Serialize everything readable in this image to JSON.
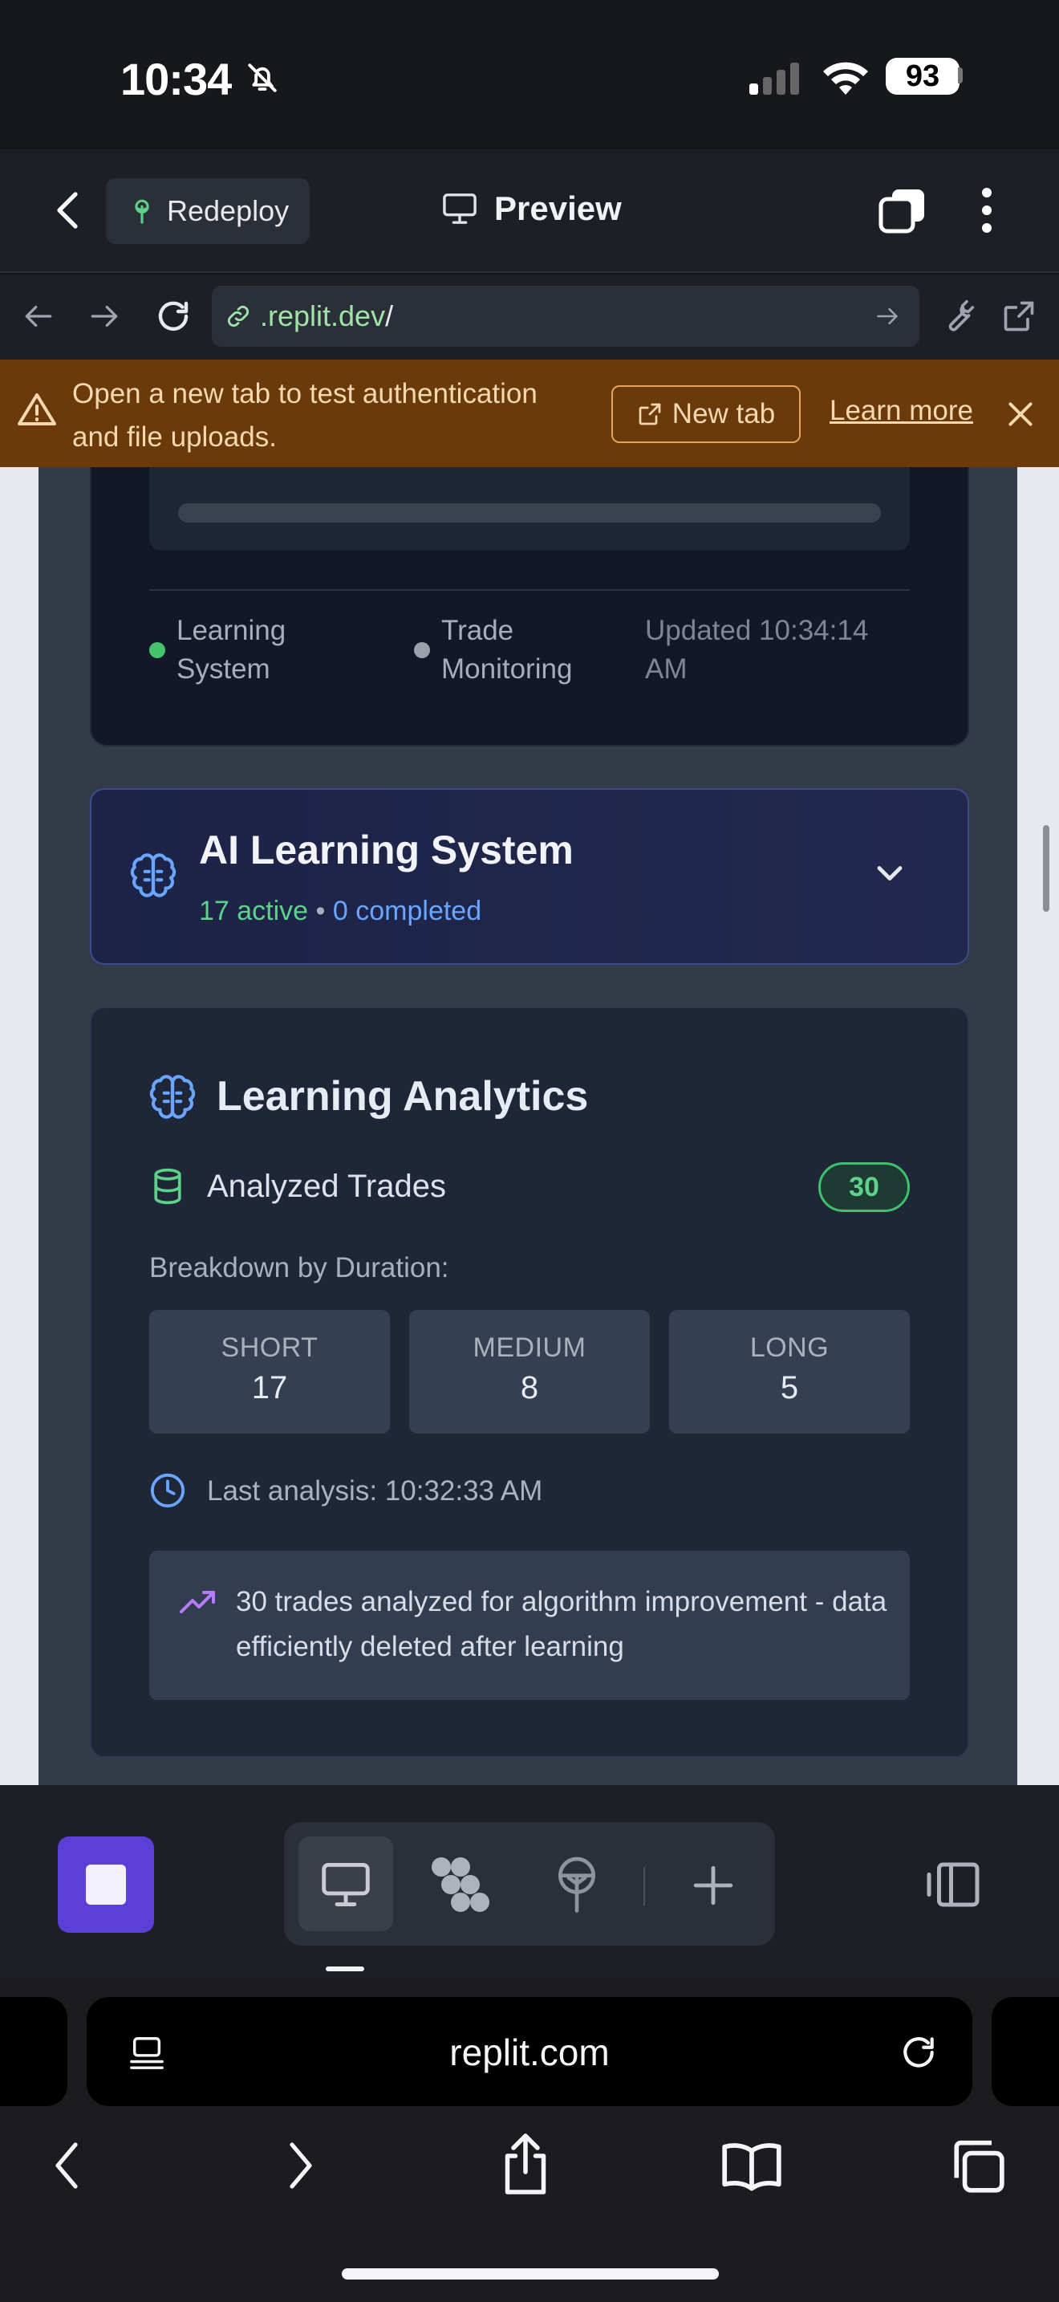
{
  "status_bar": {
    "time": "10:34",
    "battery": "93"
  },
  "replit_bar": {
    "redeploy_label": "Redeploy",
    "preview_label": "Preview"
  },
  "url_bar": {
    "domain": ".replit.dev",
    "path": "/"
  },
  "banner": {
    "message": "Open a new tab to test authentication and file uploads.",
    "new_tab_label": "New tab",
    "learn_more_label": "Learn more"
  },
  "monitor_card": {
    "learning_label": "Learning System",
    "trade_label": "Trade Monitoring",
    "updated_text": "Updated 10:34:14 AM"
  },
  "ai_learning": {
    "title": "AI Learning System",
    "active_text": "17 active",
    "separator": "•",
    "completed_text": "0 completed"
  },
  "analytics": {
    "title": "Learning Analytics",
    "analyzed_label": "Analyzed Trades",
    "analyzed_count": "30",
    "breakdown_label": "Breakdown by Duration:",
    "durations": [
      {
        "label": "SHORT",
        "value": "17"
      },
      {
        "label": "MEDIUM",
        "value": "8"
      },
      {
        "label": "LONG",
        "value": "5"
      }
    ],
    "last_analysis": "Last analysis: 10:32:33 AM",
    "note": "30 trades analyzed for algorithm improvement - data efficiently deleted after learning"
  },
  "safari": {
    "address": "replit.com"
  },
  "colors": {
    "accent_purple": "#5b3fd6",
    "success_green": "#5ed28a",
    "info_blue": "#6aa6ff",
    "warning_banner": "#6a3a0b"
  }
}
